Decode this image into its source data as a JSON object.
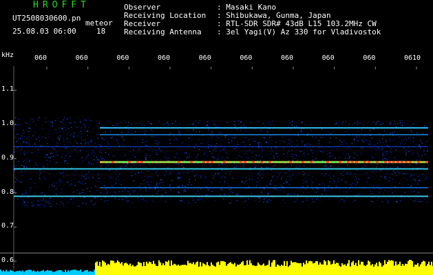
{
  "header": {
    "brand": "HROFFT",
    "filename": "UT2508030600.pn",
    "meteor_label": "meteor",
    "datetime": "25.08.03 06:00",
    "count": "18"
  },
  "info": [
    {
      "label": "Observer",
      "value": ": Masaki Kano"
    },
    {
      "label": "Receiving Location",
      "value": ": Shibukawa, Gunma, Japan"
    },
    {
      "label": "Receiver",
      "value": ": RTL-SDR SDR# 43dB L15 103.2MHz CW"
    },
    {
      "label": "Receiving Antenna",
      "value": ": 3el Yagi(V) Az 330 for Vladivostok"
    }
  ],
  "chart_data": {
    "type": "heatmap",
    "ylabel": "kHz",
    "y_ticks": [
      "1.1",
      "1.0",
      "0.9",
      "0.8",
      "0.7",
      "0.6"
    ],
    "ylim": [
      0.6,
      1.15
    ],
    "x_ticks": [
      "060",
      "060",
      "060",
      "060",
      "060",
      "060",
      "060",
      "060",
      "060",
      "0610"
    ],
    "emission_lines_khz": [
      0.99,
      0.97,
      0.935,
      0.89,
      0.87,
      0.815,
      0.79
    ],
    "strongest_line_khz": 0.89,
    "level_strip_colors": {
      "early": "#00ccff",
      "late": "#ffff00"
    }
  }
}
